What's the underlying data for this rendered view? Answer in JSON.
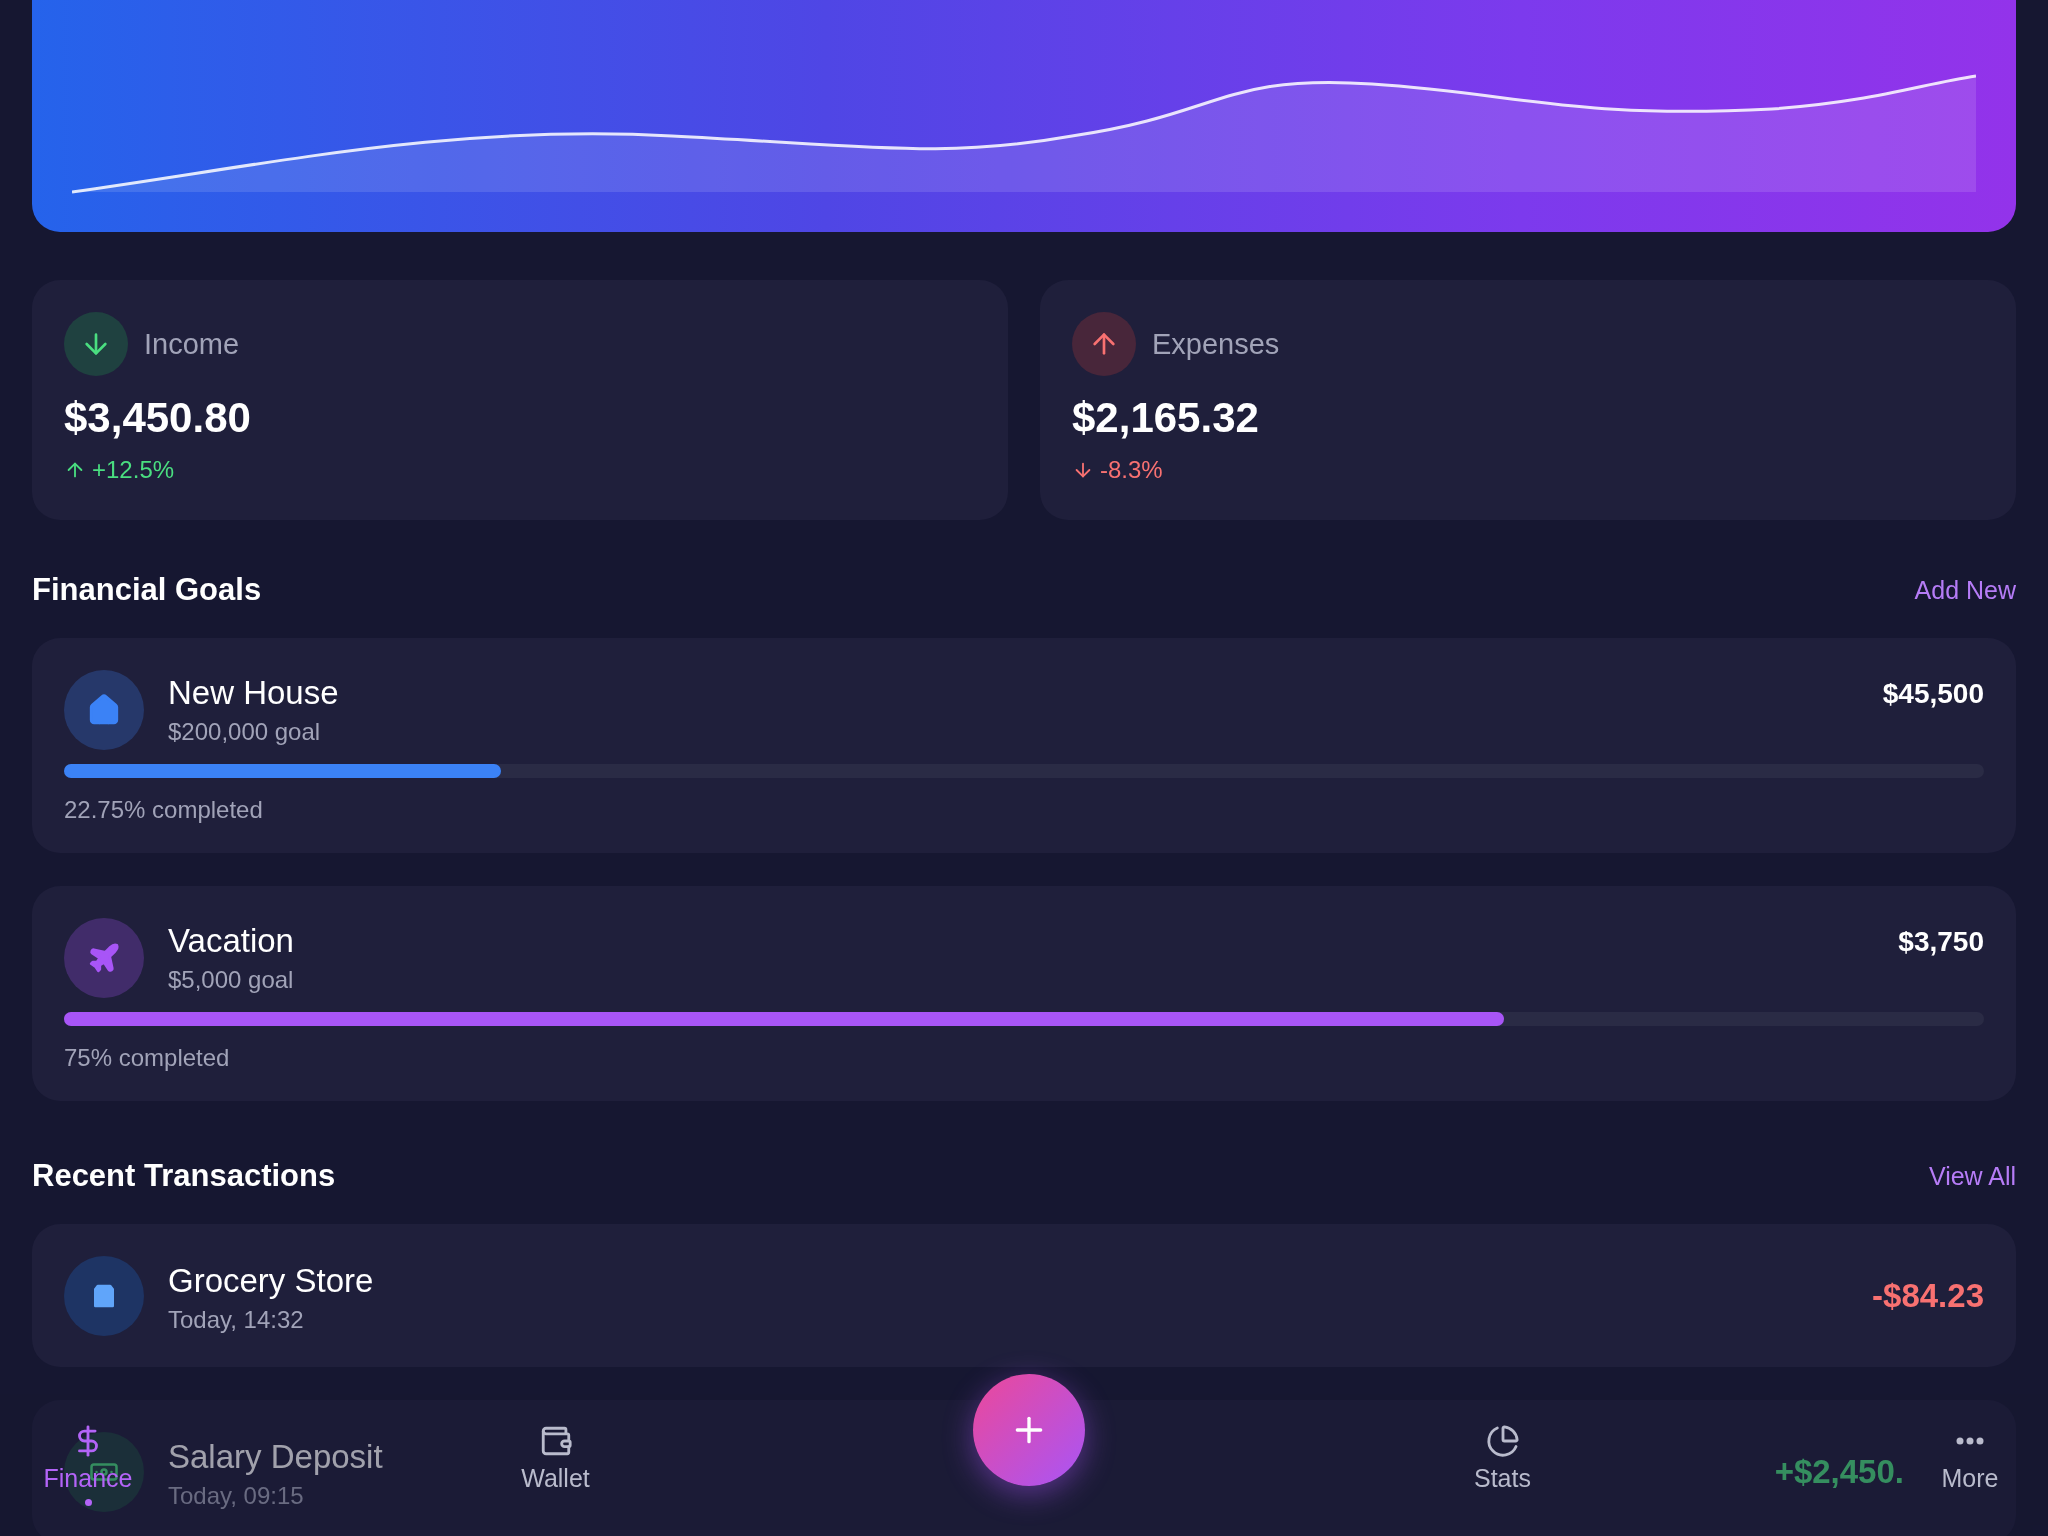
{
  "summary": [
    {
      "kind": "income",
      "label": "Income",
      "amount": "$3,450.80",
      "change": "+12.5%"
    },
    {
      "kind": "expense",
      "label": "Expenses",
      "amount": "$2,165.32",
      "change": "-8.3%"
    }
  ],
  "goals_section": {
    "title": "Financial Goals",
    "action": "Add New"
  },
  "goals": [
    {
      "kind": "house",
      "name": "New House",
      "target": "$200,000 goal",
      "saved": "$45,500",
      "level": 0.2275,
      "progress_text": "22.75% completed",
      "color": "#3b82f6"
    },
    {
      "kind": "travel",
      "name": "Vacation",
      "target": "$5,000 goal",
      "saved": "$3,750",
      "level": 0.75,
      "progress_text": "75% completed",
      "color": "#a855f7"
    }
  ],
  "transactions_section": {
    "title": "Recent Transactions",
    "action": "View All"
  },
  "transactions": [
    {
      "kind": "shopping",
      "name": "Grocery Store",
      "time": "Today, 14:32",
      "amount": "-$84.23"
    },
    {
      "kind": "salary",
      "name": "Salary Deposit",
      "time": "Today, 09:15",
      "amount": "+$2,450."
    }
  ],
  "nav": [
    {
      "kind": "finance",
      "label": "Finance",
      "selected": true
    },
    {
      "kind": "wallet",
      "label": "Wallet",
      "selected": false
    },
    {
      "kind": "add"
    },
    {
      "kind": "stats",
      "label": "Stats",
      "selected": false
    },
    {
      "kind": "more",
      "label": "More",
      "selected": false
    }
  ]
}
